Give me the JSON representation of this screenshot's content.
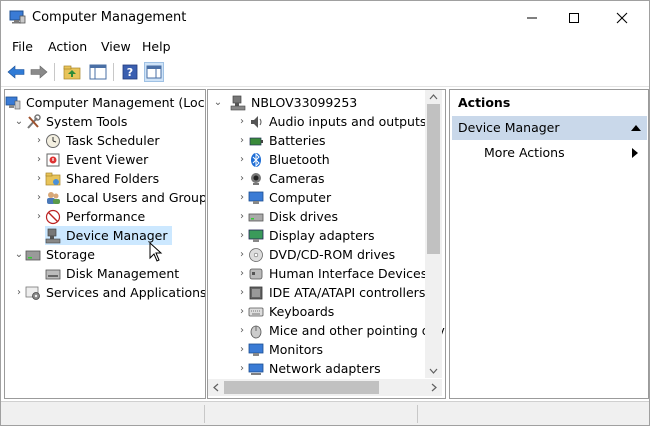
{
  "window": {
    "title": "Computer Management"
  },
  "menu": [
    "File",
    "Action",
    "View",
    "Help"
  ],
  "tree": {
    "root": "Computer Management (Local)",
    "system_tools": "System Tools",
    "task_scheduler": "Task Scheduler",
    "event_viewer": "Event Viewer",
    "shared_folders": "Shared Folders",
    "local_users": "Local Users and Groups",
    "performance": "Performance",
    "device_manager": "Device Manager",
    "storage": "Storage",
    "disk_management": "Disk Management",
    "services": "Services and Applications"
  },
  "devices": {
    "computer_name": "NBLOV33099253",
    "categories": [
      "Audio inputs and outputs",
      "Batteries",
      "Bluetooth",
      "Cameras",
      "Computer",
      "Disk drives",
      "Display adapters",
      "DVD/CD-ROM drives",
      "Human Interface Devices",
      "IDE ATA/ATAPI controllers",
      "Keyboards",
      "Mice and other pointing devices",
      "Monitors",
      "Network adapters"
    ]
  },
  "actions": {
    "header": "Actions",
    "section": "Device Manager",
    "more": "More Actions"
  },
  "colors": {
    "selection": "#cce8ff",
    "actions_header": "#c9d8ea",
    "accent": "#2b6cb0"
  }
}
